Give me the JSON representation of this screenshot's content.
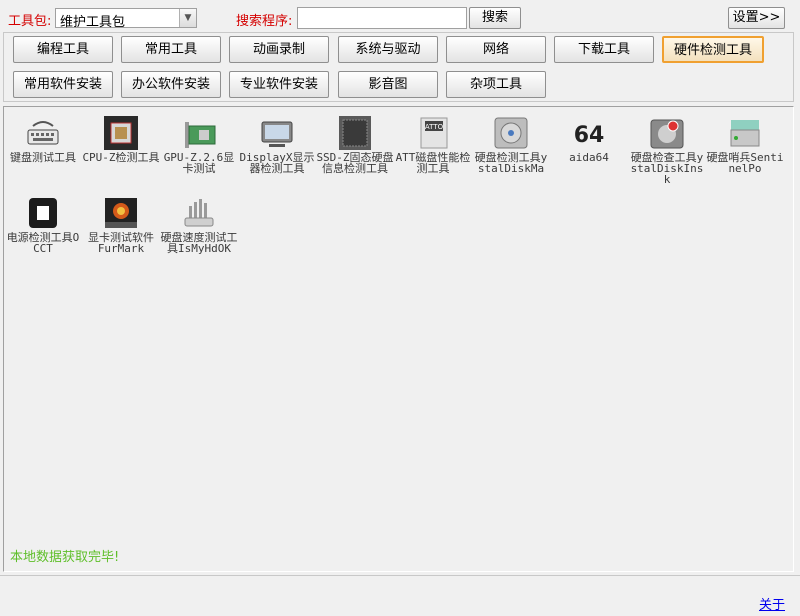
{
  "topbar": {
    "toolkit_label": "工具包:",
    "toolkit_value": "维护工具包",
    "search_label": "搜索程序:",
    "search_value": "",
    "search_button": "搜索",
    "settings_button": "设置>>"
  },
  "tabs": {
    "row1": [
      "编程工具",
      "常用工具",
      "动画录制",
      "系统与驱动",
      "网络",
      "下载工具",
      "硬件检测工具"
    ],
    "row2": [
      "常用软件安装",
      "办公软件安装",
      "专业软件安装",
      "影音图",
      "杂项工具"
    ],
    "selected": "硬件检测工具"
  },
  "tools": [
    {
      "name": "键盘测试工具",
      "icon": "keyboard-icon"
    },
    {
      "name": "CPU-Z检测工具",
      "icon": "cpu-chip-icon"
    },
    {
      "name": "GPU-Z.2.6显卡测试",
      "icon": "graphics-card-icon"
    },
    {
      "name": "DisplayX显示器检测工具",
      "icon": "monitor-icon"
    },
    {
      "name": "SSD-Z固态硬盘信息检测工具",
      "icon": "ssd-chip-icon"
    },
    {
      "name": "ATT磁盘性能检测工具",
      "icon": "atto-disk-icon"
    },
    {
      "name": "硬盘检测工具ystalDiskMa",
      "icon": "disk-check-icon"
    },
    {
      "name": "aida64",
      "icon": "aida64-icon"
    },
    {
      "name": "硬盘检查工具ystalDiskInsk",
      "icon": "disk-info-icon"
    },
    {
      "name": "硬盘哨兵SentinelPo",
      "icon": "disk-sentinel-icon"
    },
    {
      "name": "电源检测工具OCCT",
      "icon": "occt-icon"
    },
    {
      "name": "显卡测试软件 FurMark",
      "icon": "furmark-icon"
    },
    {
      "name": "硬盘速度测试工具IsMyHdOK",
      "icon": "hdd-speed-icon"
    }
  ],
  "status": "本地数据获取完毕!",
  "about_link": "关于",
  "colors": {
    "label_red": "#d40000",
    "status_green": "#5fbf2a",
    "selected_border": "#f0a030",
    "link": "#0000ee"
  }
}
